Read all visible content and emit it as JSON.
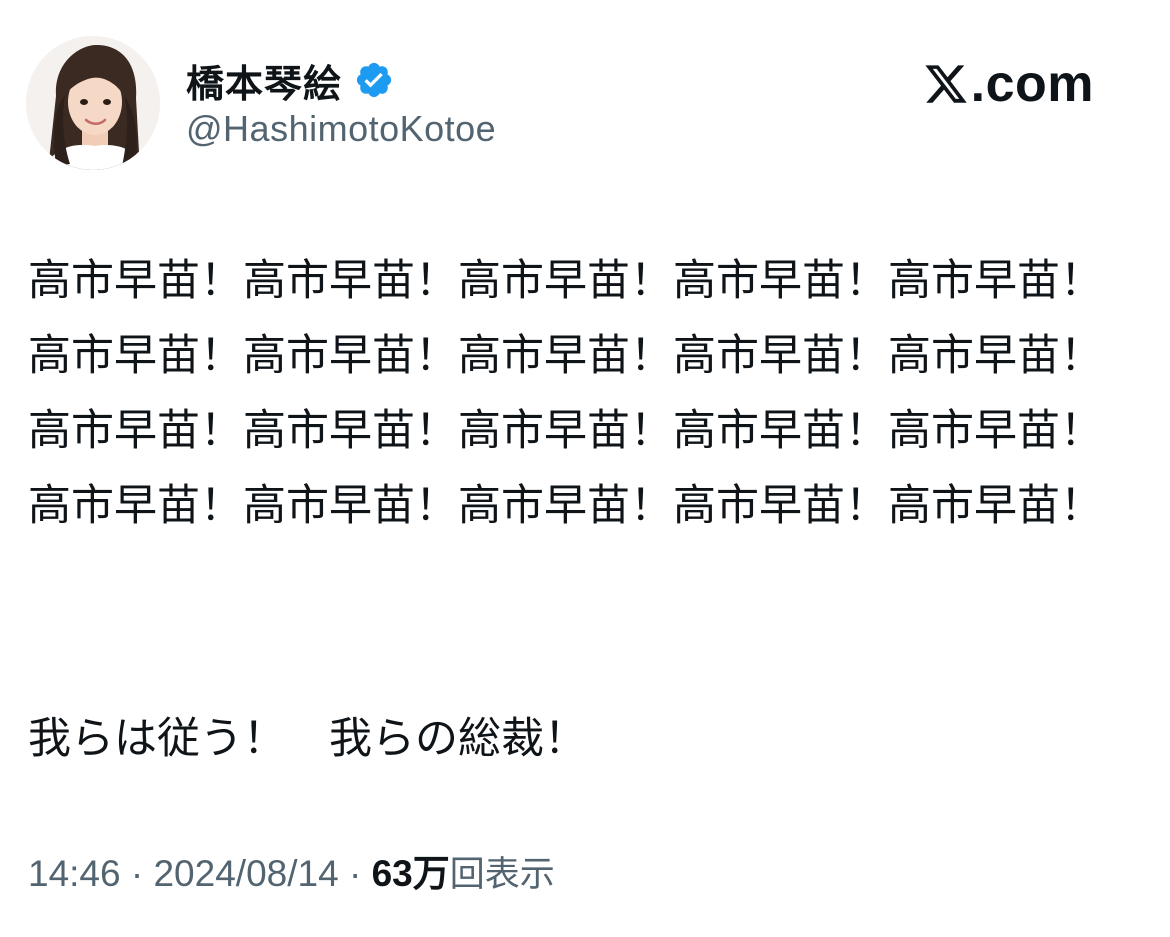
{
  "author": {
    "display_name": "橋本琴絵",
    "handle": "@HashimotoKotoe",
    "verified": true,
    "verified_color": "#1d9bf0"
  },
  "brand": {
    "logo": "x-logo-icon",
    "domain": ".com"
  },
  "tweet": {
    "paragraph_1": "高市早苗！高市早苗！高市早苗！高市早苗！高市早苗！高市早苗！高市早苗！高市早苗！高市早苗！高市早苗！高市早苗！高市早苗！高市早苗！高市早苗！高市早苗！高市早苗！高市早苗！高市早苗！高市早苗！高市早苗！",
    "paragraph_2": "我らは従う！　我らの総裁！"
  },
  "meta": {
    "time": "14:46",
    "separator": " · ",
    "date": "2024/08/14",
    "views_count": "63万",
    "views_label": "回表示"
  }
}
